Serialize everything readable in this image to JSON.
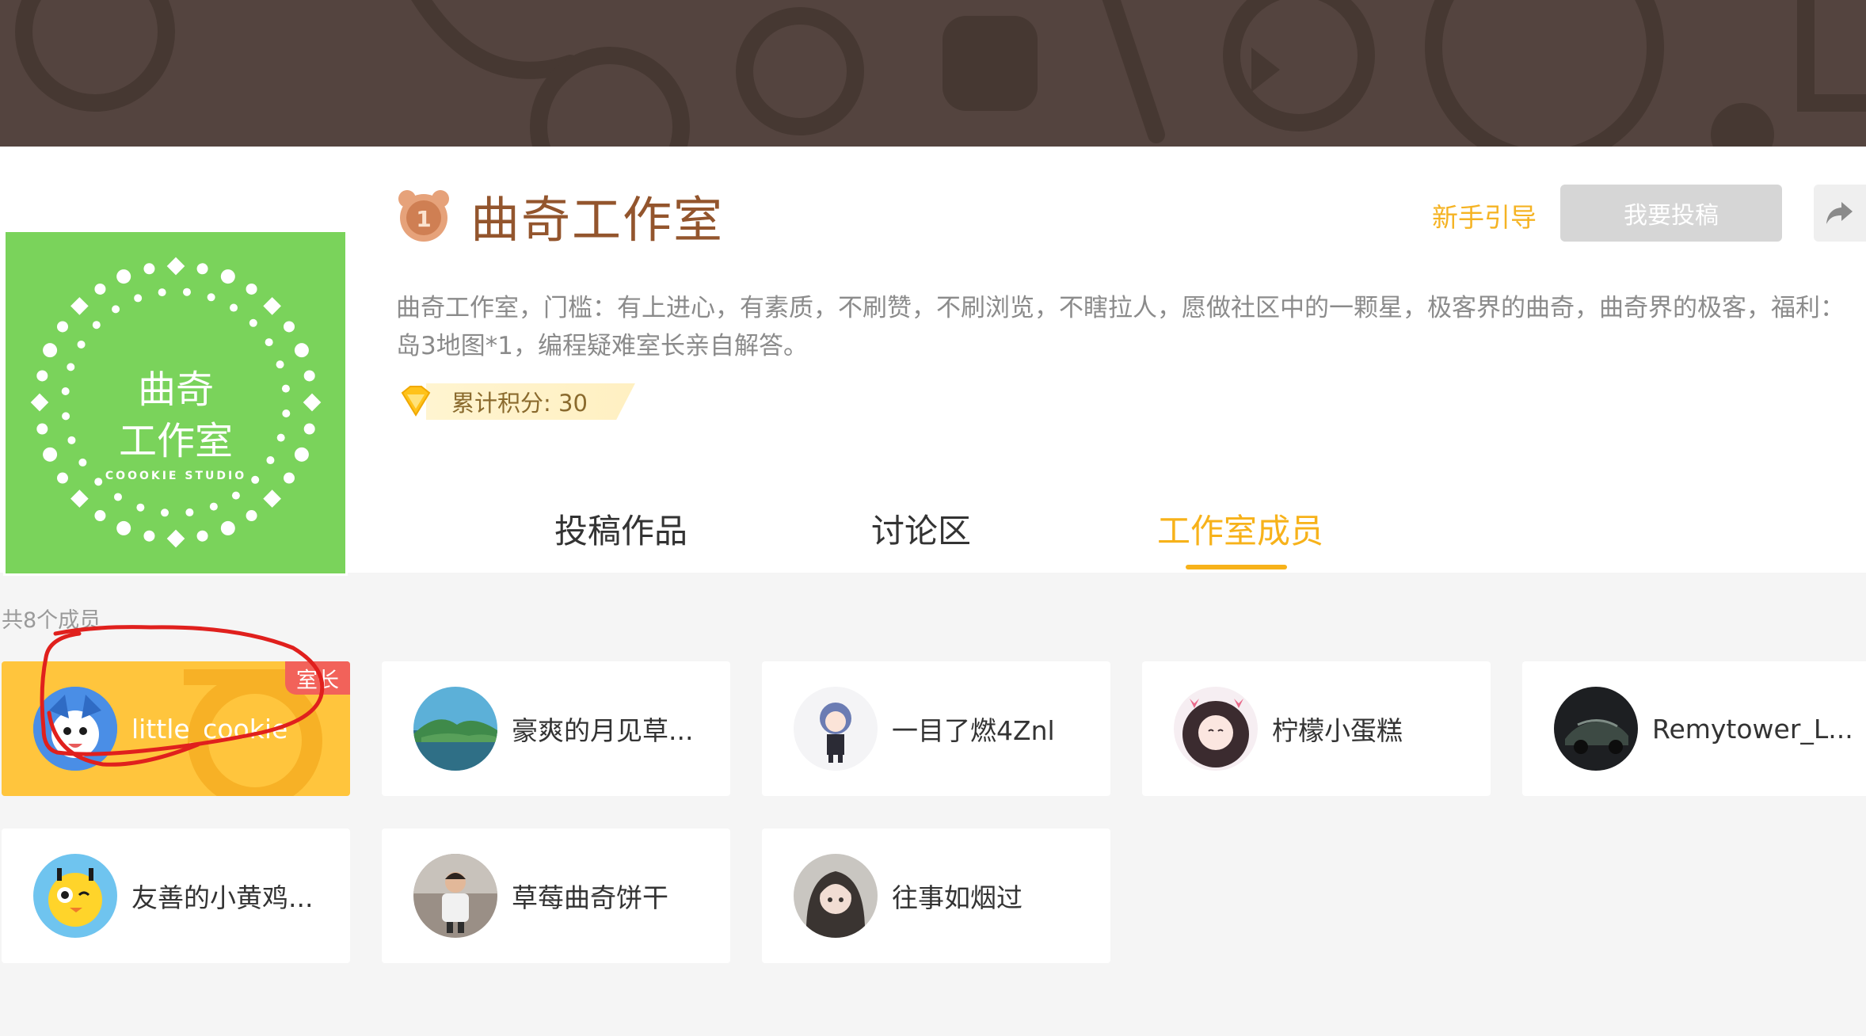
{
  "studio": {
    "name": "曲奇工作室",
    "logo_line1": "曲奇",
    "logo_line2": "工作室",
    "logo_subtitle": "COOOKIE STUDIO",
    "level": "1",
    "description": "曲奇工作室，门槛：有上进心，有素质，不刷赞，不刷浏览，不瞎拉人，愿做社区中的一颗星，极客界的曲奇，曲奇界的极客，福利：岛3地图*1，编程疑难室长亲自解答。",
    "points_label": "累计积分: 30"
  },
  "actions": {
    "guide_label": "新手引导",
    "submit_label": "我要投稿"
  },
  "tabs": [
    {
      "label": "投稿作品",
      "active": false
    },
    {
      "label": "讨论区",
      "active": false
    },
    {
      "label": "工作室成员",
      "active": true
    }
  ],
  "members_section": {
    "count_label": "共8个成员",
    "owner_badge": "室长"
  },
  "members": [
    {
      "name": "little_cookie",
      "role": "owner",
      "avatar": "blue-cartoon-avatar"
    },
    {
      "name": "豪爽的月见草...",
      "role": "member",
      "avatar": "island-avatar"
    },
    {
      "name": "一目了燃4Znl",
      "role": "member",
      "avatar": "anime-character-avatar"
    },
    {
      "name": "柠檬小蛋糕",
      "role": "member",
      "avatar": "anime-girl-avatar"
    },
    {
      "name": "Remytower_L...",
      "role": "member",
      "avatar": "car-avatar"
    },
    {
      "name": "友善的小黄鸡...",
      "role": "member",
      "avatar": "yellow-chick-avatar"
    },
    {
      "name": "草莓曲奇饼干",
      "role": "member",
      "avatar": "child-photo-avatar"
    },
    {
      "name": "往事如烟过",
      "role": "member",
      "avatar": "anime-portrait-avatar"
    }
  ],
  "colors": {
    "accent": "#f7b21a",
    "banner": "#54443f",
    "logo_bg": "#7ad35b",
    "title": "#93552d",
    "owner_card": "#ffc53d",
    "owner_badge": "#f2625a",
    "annotation": "#e0201d"
  }
}
